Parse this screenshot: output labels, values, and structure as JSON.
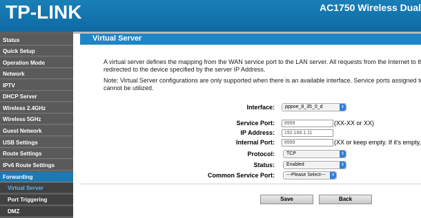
{
  "header": {
    "logo": "TP-LINK",
    "model": "AC1750 Wireless Dual"
  },
  "sidebar": {
    "items": [
      {
        "label": "Status"
      },
      {
        "label": "Quick Setup"
      },
      {
        "label": "Operation Mode"
      },
      {
        "label": "Network"
      },
      {
        "label": "IPTV"
      },
      {
        "label": "DHCP Server"
      },
      {
        "label": "Wireless 2.4GHz"
      },
      {
        "label": "Wireless 5GHz"
      },
      {
        "label": "Guest Network"
      },
      {
        "label": "USB Settings"
      },
      {
        "label": "Route Settings"
      },
      {
        "label": "IPv6 Route Settings"
      },
      {
        "label": "Forwarding"
      }
    ],
    "subitems": [
      {
        "label": "Virtual Server"
      },
      {
        "label": "Port Triggering"
      },
      {
        "label": "DMZ"
      }
    ]
  },
  "main": {
    "title": "Virtual Server",
    "description_line1": "A virtual server defines the mapping from the WAN service port to the LAN server. All requests from the Internet to the",
    "description_line2": "redirected to the device specified by the server IP Address.",
    "note_line1": "Note: Virtual Server configurations are only supported when there is an available interface. Service ports assigned to",
    "note_line2": "cannot be utilized."
  },
  "form": {
    "interface_label": "Interface:",
    "interface_value": "pppoe_8_35_0_d",
    "service_port_label": "Service Port:",
    "service_port_value": "8999",
    "service_port_hint": "(XX-XX or XX)",
    "ip_address_label": "IP Address:",
    "ip_address_value": "192.168.1.11",
    "internal_port_label": "Internal Port:",
    "internal_port_value": "8999",
    "internal_port_hint": "(XX or keep empty. If it's empty,",
    "protocol_label": "Protocol:",
    "protocol_value": "TCP",
    "status_label": "Status:",
    "status_value": "Enabled",
    "common_service_port_label": "Common Service Port:",
    "common_service_port_value": "---Please Select---"
  },
  "buttons": {
    "save": "Save",
    "back": "Back"
  },
  "colors": {
    "header_blue": "#1a7fb8",
    "title_blue": "#1e86c6",
    "sidebar_gray": "#5a5a5a",
    "active_item": "#1b7ab4",
    "active_subitem_text": "#5fb6ef"
  }
}
